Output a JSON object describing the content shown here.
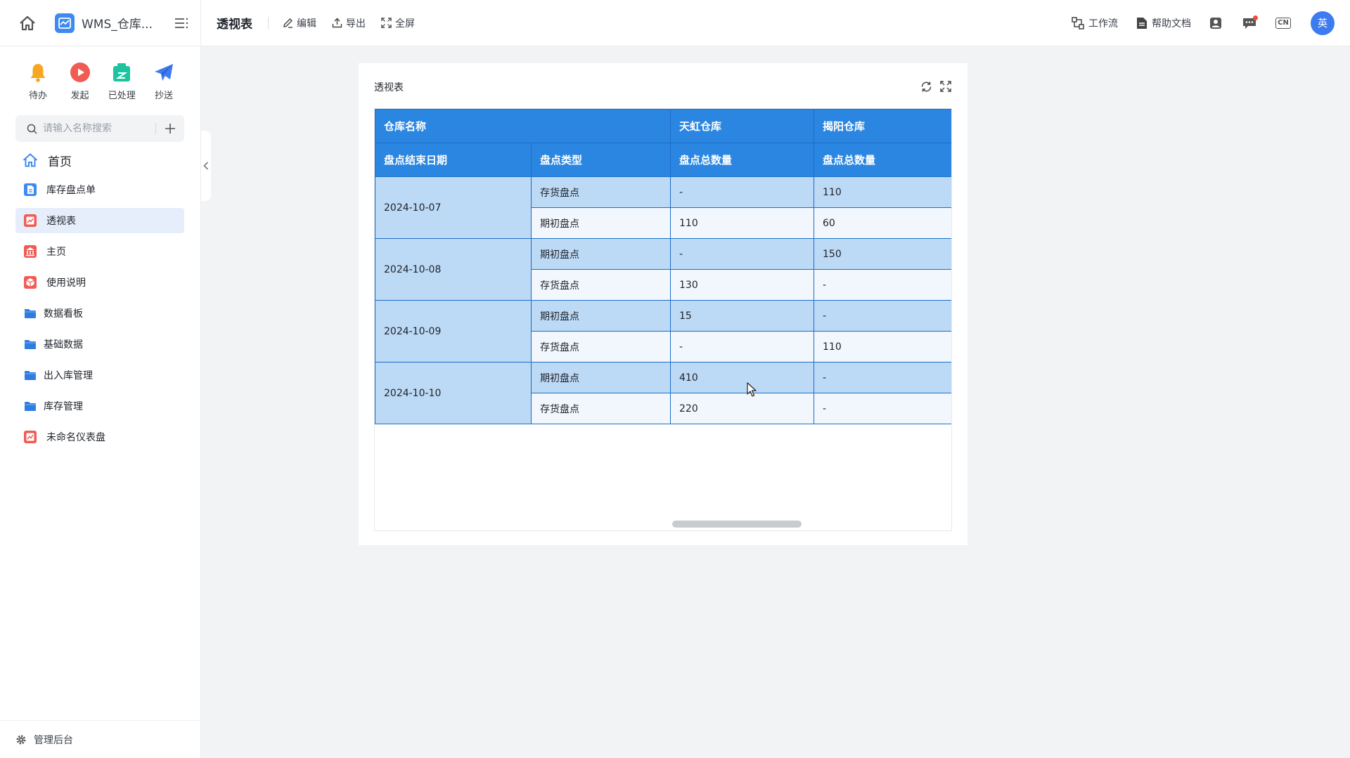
{
  "app": {
    "name": "WMS_仓库...",
    "page_title": "透视表"
  },
  "toolbar": {
    "edit": "编辑",
    "export": "导出",
    "fullscreen": "全屏"
  },
  "top_right": {
    "workflow": "工作流",
    "help": "帮助文档",
    "lang": "CN",
    "avatar": "英"
  },
  "quick_actions": [
    {
      "label": "待办",
      "icon": "bell-icon",
      "color": "#f5a623"
    },
    {
      "label": "发起",
      "icon": "play-circle-icon",
      "color": "#f05b54"
    },
    {
      "label": "已处理",
      "icon": "done-box-icon",
      "color": "#1cc4a0"
    },
    {
      "label": "抄送",
      "icon": "send-icon",
      "color": "#3d7bf0"
    }
  ],
  "search": {
    "placeholder": "请输入名称搜索"
  },
  "nav": {
    "home": "首页",
    "items": [
      {
        "label": "库存盘点单",
        "icon": "form-icon",
        "color": "#3d8bf2"
      },
      {
        "label": "透视表",
        "icon": "chart-report-icon",
        "color": "#f05b54",
        "active": true
      },
      {
        "label": "主页",
        "icon": "bank-icon",
        "color": "#f05b54"
      },
      {
        "label": "使用说明",
        "icon": "cube-icon",
        "color": "#f05b54"
      },
      {
        "label": "数据看板",
        "icon": "folder-icon",
        "color": "#2f7de1"
      },
      {
        "label": "基础数据",
        "icon": "folder-icon",
        "color": "#2f7de1"
      },
      {
        "label": "出入库管理",
        "icon": "folder-icon",
        "color": "#2f7de1"
      },
      {
        "label": "库存管理",
        "icon": "folder-icon",
        "color": "#2f7de1"
      },
      {
        "label": "未命名仪表盘",
        "icon": "chart-report-icon",
        "color": "#f05b54"
      }
    ]
  },
  "admin": {
    "label": "管理后台"
  },
  "card": {
    "title": "透视表"
  },
  "pivot": {
    "header_row1": {
      "warehouse_label": "仓库名称",
      "warehouses": [
        "天虹仓库",
        "揭阳仓库"
      ]
    },
    "header_row2": {
      "date_col": "盘点结束日期",
      "type_col": "盘点类型",
      "measure": [
        "盘点总数量",
        "盘点总数量"
      ]
    },
    "groups": [
      {
        "date": "2024-10-07",
        "rows": [
          {
            "type": "存货盘点",
            "v1": "-",
            "v2": "110"
          },
          {
            "type": "期初盘点",
            "v1": "110",
            "v2": "60"
          }
        ]
      },
      {
        "date": "2024-10-08",
        "rows": [
          {
            "type": "期初盘点",
            "v1": "-",
            "v2": "150"
          },
          {
            "type": "存货盘点",
            "v1": "130",
            "v2": "-"
          }
        ]
      },
      {
        "date": "2024-10-09",
        "rows": [
          {
            "type": "期初盘点",
            "v1": "15",
            "v2": "-"
          },
          {
            "type": "存货盘点",
            "v1": "-",
            "v2": "110"
          }
        ]
      },
      {
        "date": "2024-10-10",
        "rows": [
          {
            "type": "期初盘点",
            "v1": "410",
            "v2": "-"
          },
          {
            "type": "存货盘点",
            "v1": "220",
            "v2": "-"
          }
        ]
      }
    ]
  }
}
